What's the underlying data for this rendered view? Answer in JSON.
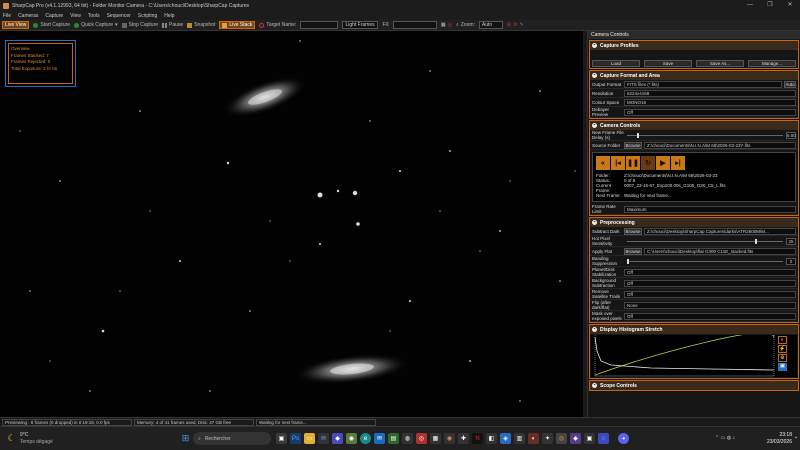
{
  "window": {
    "title": "SharpCap Pro (v4.1.12993, 64 bit) - Folder Monitor Camera - C:\\Users\\chouci\\Desktop\\SharpCap Captures",
    "controls": [
      "—",
      "❐",
      "✕"
    ]
  },
  "menu": [
    "File",
    "Cameras",
    "Capture",
    "View",
    "Tools",
    "Sequencer",
    "Scripting",
    "Help"
  ],
  "toolbar": {
    "live_view": "Live View",
    "start_capture": "Start Capture",
    "quick_capture": "Quick Capture",
    "stop_capture": "Stop Capture",
    "pause": "Pause",
    "snapshot": "Snapshot",
    "live_stack": "Live Stack",
    "target_name": "Target Name:",
    "light_frames": "Light Frames",
    "fx": "FX",
    "zoom": "Zoom:",
    "zoom_value": "Auto"
  },
  "overview": {
    "title": "Overview",
    "frames_stacked": "Frames Stacked:   7",
    "frames_rejected": "Frames Rejected:  0",
    "total_exposure": "Total Exposure:    2 hr 0s"
  },
  "panel": {
    "title": "Camera Controls",
    "capture_profiles": {
      "title": "Capture Profiles",
      "load": "Load",
      "save": "Save",
      "save_as": "Save As...",
      "manage": "Manage..."
    },
    "capture_format": {
      "title": "Capture Format and Area",
      "output_format_label": "Output Format",
      "output_format_value": "FITS files (*.fits)",
      "auto": "Auto",
      "resolution_label": "Resolution",
      "resolution_value": "6224x4168",
      "colour_space_label": "Colour Space",
      "colour_space_value": "MONO16",
      "debayer_label": "Debayer Preview",
      "debayer_value": "Off"
    },
    "camera_controls": {
      "title": "Camera Controls",
      "new_frame_label": "New Frame File Delay (s)",
      "new_frame_value": "5.00",
      "source_folder_label": "Source Folder",
      "browse": "Browse",
      "source_folder_value": "Z:\\chouci\\Documents\\N.I.N.A\\M 66\\2026-03-23\\*.fits",
      "player": {
        "folder_key": "Folder:",
        "folder_val": "Z:\\chouci\\Documents\\N.I.N.A\\M 66\\2026-03-23",
        "status_key": "Status:",
        "status_val": "0 of 8",
        "current_key": "Current Frame:",
        "current_val": "0007_23-15-57_Exp100.00s_G100_O30_C5_L.fits",
        "next_key": "Next Frame:",
        "next_val": "Waiting for next frame..."
      },
      "frame_rate_label": "Frame Rate Limit",
      "frame_rate_value": "Maximum"
    },
    "preprocessing": {
      "title": "Preprocessing",
      "subtract_dark_label": "Subtract Dark",
      "subtract_dark_value": "Z:\\chouci\\Desktop\\SharpCap Captures\\darks\\ATR2600M\\M...",
      "hot_pixel_label": "Hot Pixel Sensitivity",
      "hot_pixel_value": "25",
      "apply_flat_label": "Apply Flat",
      "apply_flat_value": "C:\\Users\\chouci\\Desktop\\flat G300 C11E_stacked.fits",
      "banding_label": "Banding Suppression",
      "banding_value": "0",
      "planet_label": "Planet/Disk Stabilization",
      "planet_value": "Off",
      "background_label": "Background Subtraction",
      "background_value": "Off",
      "satellite_label": "Remove Satellite Trails",
      "satellite_value": "Off",
      "flip_label": "Flip (after dark/flat)",
      "flip_value": "None",
      "mask_label": "Mask over exposed pixels",
      "mask_value": "Off"
    },
    "histogram": {
      "title": "Display Histogram Stretch"
    },
    "scope": {
      "title": "Scope Controls"
    }
  },
  "statusbar": {
    "preview": "Previewing : 8 frames (0 dropped) in 0:19:18, 0.0 fps",
    "memory": "Memory: 4 of 41 frames used, Disk: 37 GB free",
    "waiting": "Waiting for next frame..."
  },
  "taskbar": {
    "weather_temp": "9°C",
    "weather_desc": "Temps dégagé",
    "search": "Rechercher",
    "time": "23:18",
    "date": "23/03/2026"
  }
}
